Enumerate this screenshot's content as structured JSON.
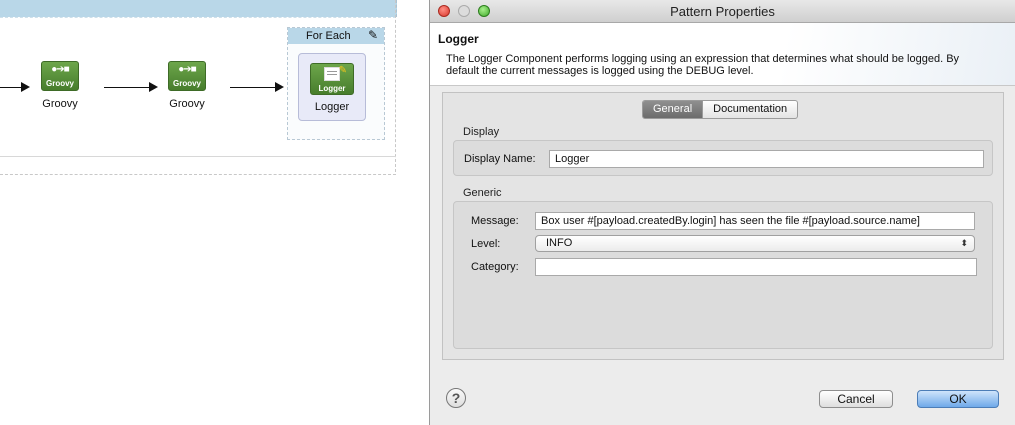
{
  "canvas": {
    "nodes": [
      {
        "icon_caption": "Groovy",
        "label": "Groovy"
      },
      {
        "icon_caption": "Groovy",
        "label": "Groovy"
      }
    ],
    "foreach": {
      "title": "For Each",
      "edit_icon": "edit-icon"
    },
    "logger_node": {
      "icon_caption": "Logger",
      "label": "Logger"
    }
  },
  "dialog": {
    "window_title": "Pattern Properties",
    "component_name": "Logger",
    "description": "The Logger Component performs logging using an expression that determines what should be logged. By default the current messages is logged using the DEBUG level.",
    "tabs": [
      {
        "label": "General",
        "active": true
      },
      {
        "label": "Documentation",
        "active": false
      }
    ],
    "display_group": {
      "title": "Display",
      "display_name_label": "Display Name:",
      "display_name_value": "Logger"
    },
    "generic_group": {
      "title": "Generic",
      "message_label": "Message:",
      "message_value": "Box user #[payload.createdBy.login] has seen the file #[payload.source.name]",
      "level_label": "Level:",
      "level_value": "INFO",
      "category_label": "Category:",
      "category_value": ""
    },
    "help_label": "?",
    "cancel_label": "Cancel",
    "ok_label": "OK"
  },
  "colors": {
    "flow_header": "#b9d7e8",
    "node_green": "#477d2c",
    "ok_blue": "#6fa9e9"
  }
}
